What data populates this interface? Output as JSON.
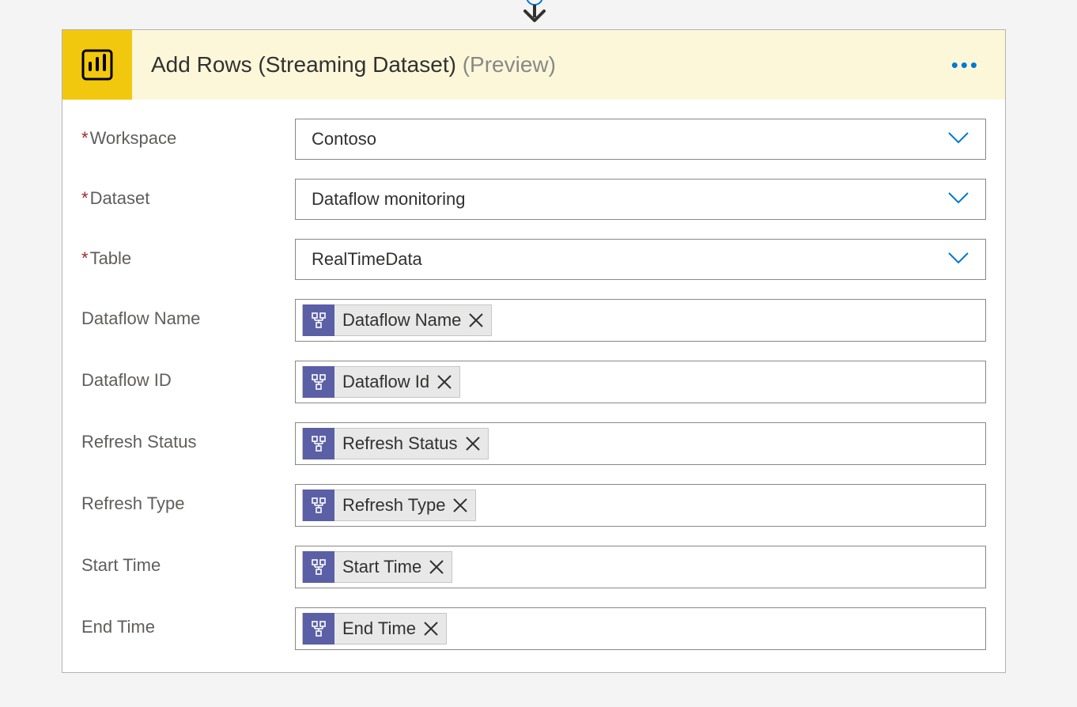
{
  "header": {
    "title_main": "Add Rows (Streaming Dataset)",
    "title_suffix": "(Preview)"
  },
  "dropdowns": {
    "workspace": {
      "label": "Workspace",
      "required": true,
      "value": "Contoso"
    },
    "dataset": {
      "label": "Dataset",
      "required": true,
      "value": "Dataflow monitoring"
    },
    "table": {
      "label": "Table",
      "required": true,
      "value": "RealTimeData"
    }
  },
  "fields": [
    {
      "label": "Dataflow Name",
      "token": "Dataflow Name"
    },
    {
      "label": "Dataflow ID",
      "token": "Dataflow Id"
    },
    {
      "label": "Refresh Status",
      "token": "Refresh Status"
    },
    {
      "label": "Refresh Type",
      "token": "Refresh Type"
    },
    {
      "label": "Start Time",
      "token": "Start Time"
    },
    {
      "label": "End Time",
      "token": "End Time"
    }
  ]
}
